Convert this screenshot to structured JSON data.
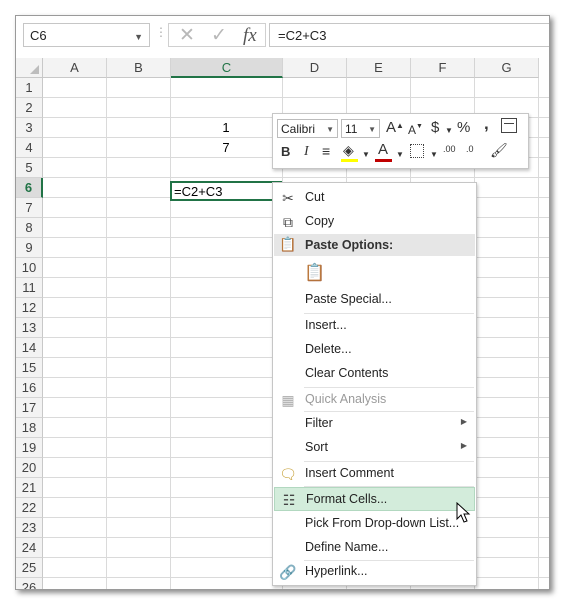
{
  "formula_bar": {
    "name_box": "C6",
    "formula": "=C2+C3",
    "fx_label": "fx"
  },
  "columns": [
    "A",
    "B",
    "C",
    "D",
    "E",
    "F",
    "G"
  ],
  "rows": [
    "1",
    "2",
    "3",
    "4",
    "5",
    "6",
    "7",
    "8",
    "9",
    "10",
    "11",
    "12",
    "13",
    "14",
    "15",
    "16",
    "17",
    "18",
    "19",
    "20",
    "21",
    "22",
    "23",
    "24",
    "25",
    "26"
  ],
  "selected_column": "C",
  "selected_row": "6",
  "cells": {
    "C2": "1",
    "C3": "7",
    "C6": "=C2+C3"
  },
  "mini_toolbar": {
    "font_name": "Calibri",
    "font_size": "11",
    "grow_label": "A",
    "shrink_label": "A",
    "currency_label": "$",
    "percent_label": "%",
    "comma_label": ",",
    "bold_label": "B",
    "italic_label": "I",
    "font_color_label": "A",
    "increase_decimal_label": ".00",
    "decrease_decimal_label": ".0",
    "colors": {
      "highlight": "#ffff00",
      "font": "#c00000"
    }
  },
  "context_menu": {
    "cut": "Cut",
    "copy": "Copy",
    "paste_options_header": "Paste Options:",
    "paste_special": "Paste Special...",
    "insert": "Insert...",
    "delete": "Delete...",
    "clear_contents": "Clear Contents",
    "quick_analysis": "Quick Analysis",
    "filter": "Filter",
    "sort": "Sort",
    "insert_comment": "Insert Comment",
    "format_cells": "Format Cells...",
    "pick_from_list": "Pick From Drop-down List...",
    "define_name": "Define Name...",
    "hyperlink": "Hyperlink..."
  },
  "colors": {
    "accent": "#217346",
    "highlight": "#d3ecdb"
  }
}
